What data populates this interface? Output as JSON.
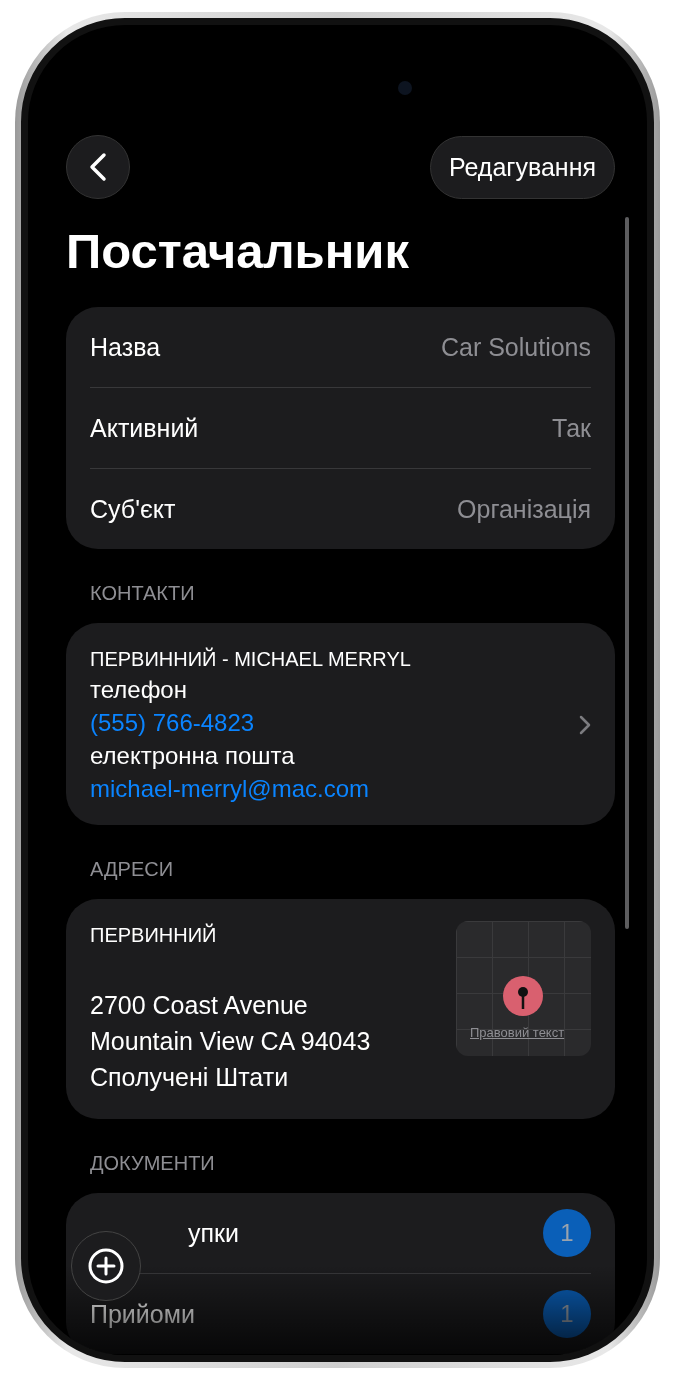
{
  "nav": {
    "edit": "Редагування"
  },
  "title": "Постачальник",
  "details": [
    {
      "label": "Назва",
      "value": "Car Solutions"
    },
    {
      "label": "Активний",
      "value": "Так"
    },
    {
      "label": "Суб'єкт",
      "value": "Організація"
    }
  ],
  "contacts": {
    "header": "КОНТАКТИ",
    "name": "ПЕРВИННИЙ - MICHAEL MERRYL",
    "phone_label": "телефон",
    "phone": "(555) 766-4823",
    "email_label": "електронна пошта",
    "email": "michael-merryl@mac.com"
  },
  "addresses": {
    "header": "АДРЕСИ",
    "label": "ПЕРВИННИЙ",
    "lines": [
      "2700 Coast Avenue",
      "Mountain View CA 94043",
      "Сполучені Штати"
    ],
    "map_legal": "Правовий текст"
  },
  "documents": {
    "header": "ДОКУМЕНТИ",
    "items": [
      {
        "label": "упки",
        "count": "1"
      },
      {
        "label": "Прийоми",
        "count": "1"
      }
    ]
  }
}
